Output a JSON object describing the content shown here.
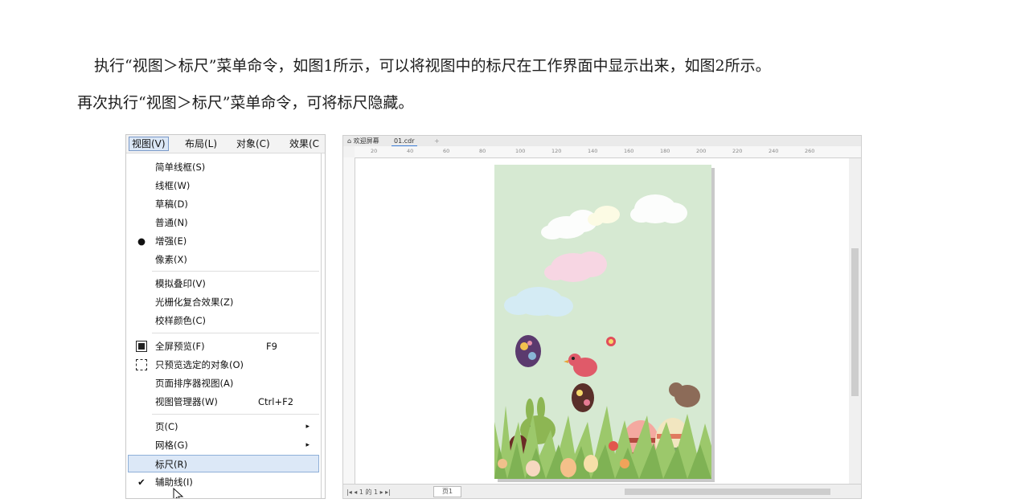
{
  "paragraphs": {
    "line1": "执行“视图＞标尺”菜单命令，如图1所示，可以将视图中的标尺在工作界面中显示出来，如图2所示。",
    "line2": "再次执行“视图＞标尺”菜单命令，可将标尺隐藏。"
  },
  "menubar": {
    "view": "视图(V)",
    "layout": "布局(L)",
    "object": "对象(C)",
    "effect": "效果(C"
  },
  "menu": {
    "simple_wireframe": "简单线框(S)",
    "wireframe": "线框(W)",
    "draft": "草稿(D)",
    "normal": "普通(N)",
    "enhanced": "增强(E)",
    "pixels": "像素(X)",
    "simulate_overprint": "模拟叠印(V)",
    "rasterize_composite": "光栅化复合效果(Z)",
    "proof_colors": "校样颜色(C)",
    "fullscreen_preview": "全屏预览(F)",
    "fullscreen_shortcut": "F9",
    "preview_selected": "只预览选定的对象(O)",
    "page_sorter": "页面排序器视图(A)",
    "view_manager": "视图管理器(W)",
    "view_manager_shortcut": "Ctrl+F2",
    "page": "页(C)",
    "grid": "网格(G)",
    "rulers": "标尺(R)",
    "guidelines": "辅助线(I)",
    "enhanced_mark": "●",
    "guidelines_mark": "✔",
    "submenu_arrow": "▸"
  },
  "workspace": {
    "tab_home": "欢迎屏幕",
    "tab_file": "01.cdr",
    "tab_add": "+",
    "page_info": "|◂ ◂ 1 的 1 ▸ ▸|",
    "page_tab": "页1",
    "hruler_ticks": [
      "20",
      "40",
      "60",
      "80",
      "100",
      "120",
      "140",
      "160",
      "180",
      "200",
      "220",
      "240",
      "260"
    ]
  },
  "colors": {
    "highlight": "#dce8f7",
    "page_bg": "#d6e9d2",
    "accent": "#3a7bd5"
  }
}
